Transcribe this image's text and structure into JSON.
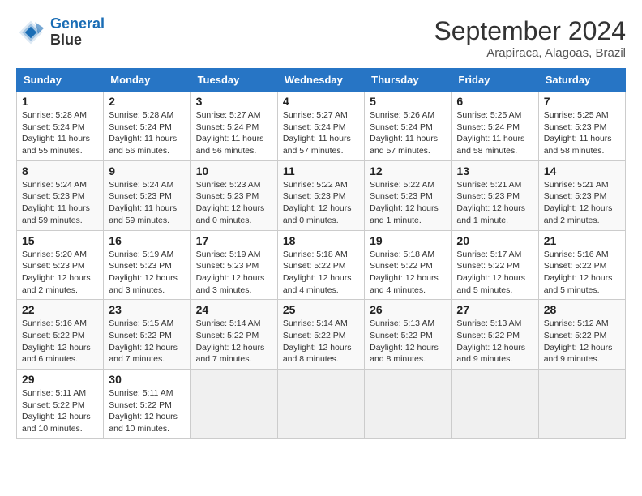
{
  "logo": {
    "line1": "General",
    "line2": "Blue"
  },
  "title": "September 2024",
  "subtitle": "Arapiraca, Alagoas, Brazil",
  "days_of_week": [
    "Sunday",
    "Monday",
    "Tuesday",
    "Wednesday",
    "Thursday",
    "Friday",
    "Saturday"
  ],
  "weeks": [
    [
      {
        "day": "1",
        "info": "Sunrise: 5:28 AM\nSunset: 5:24 PM\nDaylight: 11 hours\nand 55 minutes."
      },
      {
        "day": "2",
        "info": "Sunrise: 5:28 AM\nSunset: 5:24 PM\nDaylight: 11 hours\nand 56 minutes."
      },
      {
        "day": "3",
        "info": "Sunrise: 5:27 AM\nSunset: 5:24 PM\nDaylight: 11 hours\nand 56 minutes."
      },
      {
        "day": "4",
        "info": "Sunrise: 5:27 AM\nSunset: 5:24 PM\nDaylight: 11 hours\nand 57 minutes."
      },
      {
        "day": "5",
        "info": "Sunrise: 5:26 AM\nSunset: 5:24 PM\nDaylight: 11 hours\nand 57 minutes."
      },
      {
        "day": "6",
        "info": "Sunrise: 5:25 AM\nSunset: 5:24 PM\nDaylight: 11 hours\nand 58 minutes."
      },
      {
        "day": "7",
        "info": "Sunrise: 5:25 AM\nSunset: 5:23 PM\nDaylight: 11 hours\nand 58 minutes."
      }
    ],
    [
      {
        "day": "8",
        "info": "Sunrise: 5:24 AM\nSunset: 5:23 PM\nDaylight: 11 hours\nand 59 minutes."
      },
      {
        "day": "9",
        "info": "Sunrise: 5:24 AM\nSunset: 5:23 PM\nDaylight: 11 hours\nand 59 minutes."
      },
      {
        "day": "10",
        "info": "Sunrise: 5:23 AM\nSunset: 5:23 PM\nDaylight: 12 hours\nand 0 minutes."
      },
      {
        "day": "11",
        "info": "Sunrise: 5:22 AM\nSunset: 5:23 PM\nDaylight: 12 hours\nand 0 minutes."
      },
      {
        "day": "12",
        "info": "Sunrise: 5:22 AM\nSunset: 5:23 PM\nDaylight: 12 hours\nand 1 minute."
      },
      {
        "day": "13",
        "info": "Sunrise: 5:21 AM\nSunset: 5:23 PM\nDaylight: 12 hours\nand 1 minute."
      },
      {
        "day": "14",
        "info": "Sunrise: 5:21 AM\nSunset: 5:23 PM\nDaylight: 12 hours\nand 2 minutes."
      }
    ],
    [
      {
        "day": "15",
        "info": "Sunrise: 5:20 AM\nSunset: 5:23 PM\nDaylight: 12 hours\nand 2 minutes."
      },
      {
        "day": "16",
        "info": "Sunrise: 5:19 AM\nSunset: 5:23 PM\nDaylight: 12 hours\nand 3 minutes."
      },
      {
        "day": "17",
        "info": "Sunrise: 5:19 AM\nSunset: 5:23 PM\nDaylight: 12 hours\nand 3 minutes."
      },
      {
        "day": "18",
        "info": "Sunrise: 5:18 AM\nSunset: 5:22 PM\nDaylight: 12 hours\nand 4 minutes."
      },
      {
        "day": "19",
        "info": "Sunrise: 5:18 AM\nSunset: 5:22 PM\nDaylight: 12 hours\nand 4 minutes."
      },
      {
        "day": "20",
        "info": "Sunrise: 5:17 AM\nSunset: 5:22 PM\nDaylight: 12 hours\nand 5 minutes."
      },
      {
        "day": "21",
        "info": "Sunrise: 5:16 AM\nSunset: 5:22 PM\nDaylight: 12 hours\nand 5 minutes."
      }
    ],
    [
      {
        "day": "22",
        "info": "Sunrise: 5:16 AM\nSunset: 5:22 PM\nDaylight: 12 hours\nand 6 minutes."
      },
      {
        "day": "23",
        "info": "Sunrise: 5:15 AM\nSunset: 5:22 PM\nDaylight: 12 hours\nand 7 minutes."
      },
      {
        "day": "24",
        "info": "Sunrise: 5:14 AM\nSunset: 5:22 PM\nDaylight: 12 hours\nand 7 minutes."
      },
      {
        "day": "25",
        "info": "Sunrise: 5:14 AM\nSunset: 5:22 PM\nDaylight: 12 hours\nand 8 minutes."
      },
      {
        "day": "26",
        "info": "Sunrise: 5:13 AM\nSunset: 5:22 PM\nDaylight: 12 hours\nand 8 minutes."
      },
      {
        "day": "27",
        "info": "Sunrise: 5:13 AM\nSunset: 5:22 PM\nDaylight: 12 hours\nand 9 minutes."
      },
      {
        "day": "28",
        "info": "Sunrise: 5:12 AM\nSunset: 5:22 PM\nDaylight: 12 hours\nand 9 minutes."
      }
    ],
    [
      {
        "day": "29",
        "info": "Sunrise: 5:11 AM\nSunset: 5:22 PM\nDaylight: 12 hours\nand 10 minutes."
      },
      {
        "day": "30",
        "info": "Sunrise: 5:11 AM\nSunset: 5:22 PM\nDaylight: 12 hours\nand 10 minutes."
      },
      {
        "day": "",
        "info": ""
      },
      {
        "day": "",
        "info": ""
      },
      {
        "day": "",
        "info": ""
      },
      {
        "day": "",
        "info": ""
      },
      {
        "day": "",
        "info": ""
      }
    ]
  ]
}
